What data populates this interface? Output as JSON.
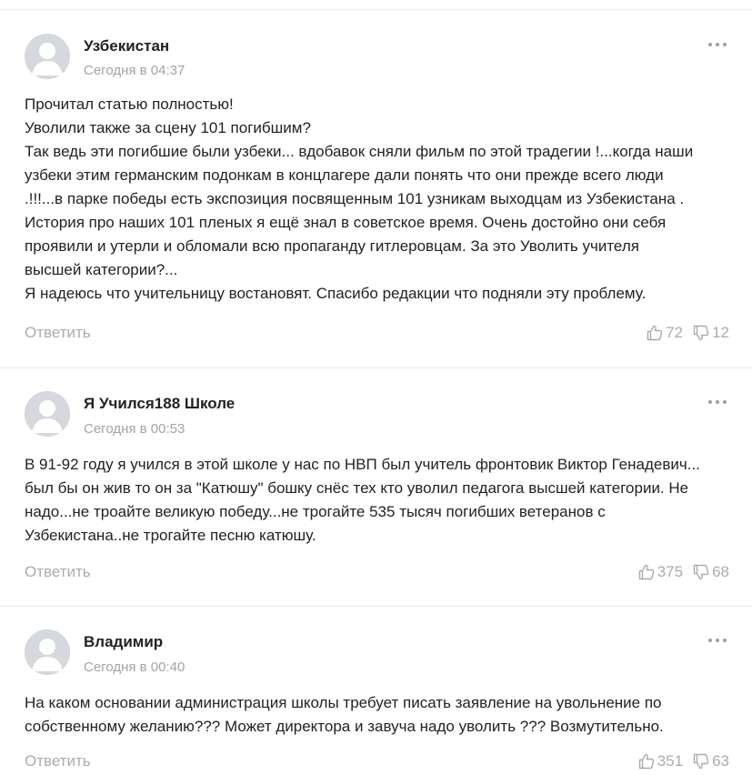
{
  "comments": [
    {
      "author": "Узбекистан",
      "time": "Сегодня в 04:37",
      "lines": [
        "Прочитал статью полностью!",
        "Уволили также за сцену 101 погибшим?",
        "Так ведь эти погибшие были узбеки... вдобавок сняли фильм по этой традегии !...когда наши",
        "узбеки этим германским подонкам в концлагере дали понять что они прежде всего люди",
        ".!!!...в парке победы есть экспозиция посвященным 101 узникам выходцам из Узбекистана .",
        "История про наших 101 пленых я ещё знал в советское время. Очень достойно они себя",
        "проявили и утерли и обломали всю пропаганду гитлеровцам. За это Уволить учителя",
        "высшей категории?...",
        "Я надеюсь что учительницу востановят. Спасибо редакции что подняли эту проблему."
      ],
      "reply": "Ответить",
      "likes": "72",
      "dislikes": "12"
    },
    {
      "author": "Я Учился188 Школе",
      "time": "Сегодня в 00:53",
      "lines": [
        "В 91-92 году я учился в этой школе у нас по НВП был учитель фронтовик Виктор Генадевич...",
        "был бы он жив то он за \"Катюшу\" бошку снёс тех кто уволил педагога высшей категории. Не",
        "надо...не троайте великую победу...не трогайте 535 тысяч погибших ветеранов с",
        "Узбекистана..не трогайте песню катюшу."
      ],
      "reply": "Ответить",
      "likes": "375",
      "dislikes": "68"
    },
    {
      "author": "Владимир",
      "time": "Сегодня в 00:40",
      "lines": [
        "На каком основании администрация школы требует писать заявление на увольнение по",
        "собственному желанию??? Может директора и завуча надо уволить ??? Возмутительно."
      ],
      "reply": "Ответить",
      "likes": "351",
      "dislikes": "63"
    }
  ],
  "icons": {
    "avatar": "user-silhouette",
    "more": "more-dots-icon",
    "like": "thumbs-up-icon",
    "dislike": "thumbs-down-icon"
  },
  "colors": {
    "muted": "#a8acb2",
    "avatar_bg": "#d5d8dc",
    "text": "#222222"
  }
}
